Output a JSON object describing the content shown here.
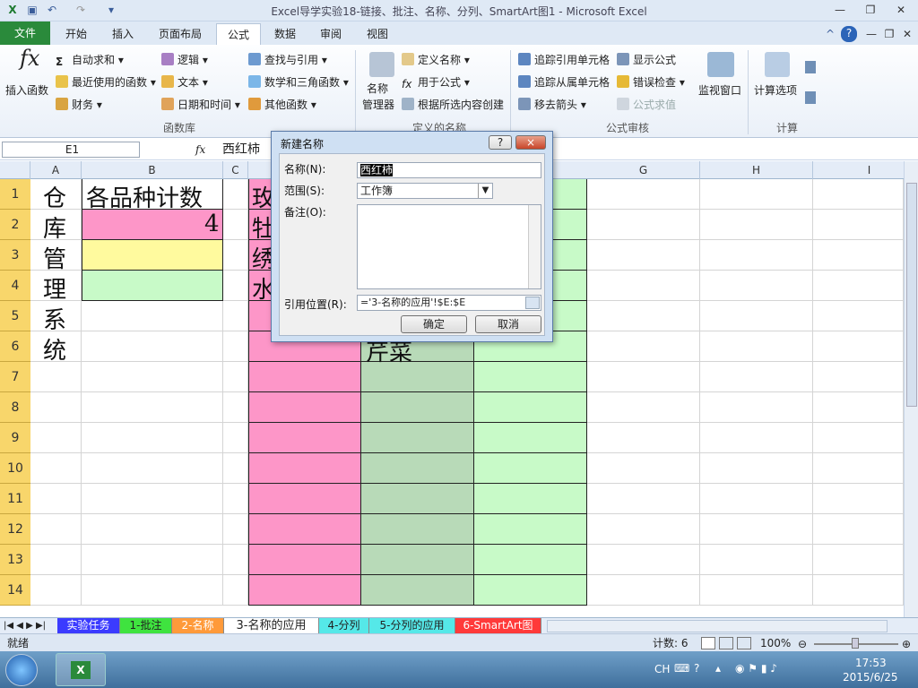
{
  "window": {
    "title": "Excel导学实验18-链接、批注、名称、分列、SmartArt图1 - Microsoft Excel"
  },
  "tabs": [
    "文件",
    "开始",
    "插入",
    "页面布局",
    "公式",
    "数据",
    "审阅",
    "视图"
  ],
  "ribbon": {
    "insert_function": "插入函数",
    "autosum": "自动求和",
    "recent": "最近使用的函数",
    "finance": "财务",
    "logic": "逻辑",
    "text": "文本",
    "datetime": "日期和时间",
    "lookup": "查找与引用",
    "math": "数学和三角函数",
    "more": "其他函数",
    "group_library": "函数库",
    "name_manager_1": "名称",
    "name_manager_2": "管理器",
    "define_name": "定义名称",
    "use_in_formula": "用于公式",
    "create_from_sel": "根据所选内容创建",
    "group_names": "定义的名称",
    "trace_prec": "追踪引用单元格",
    "trace_dep": "追踪从属单元格",
    "remove_arrows": "移去箭头",
    "show_formulas": "显示公式",
    "error_check": "错误检查",
    "eval_formula": "公式求值",
    "group_audit": "公式审核",
    "watch": "监视窗口",
    "calc_options": "计算选项",
    "group_calc": "计算"
  },
  "formula_bar": {
    "namebox": "E1",
    "fx": "fx",
    "content": "西红柿"
  },
  "columns": [
    "A",
    "B",
    "C",
    "G",
    "H",
    "I"
  ],
  "rows": [
    "1",
    "2",
    "3",
    "4",
    "5",
    "6",
    "7",
    "8",
    "9",
    "10",
    "11",
    "12",
    "13",
    "14"
  ],
  "cells": {
    "a_col": [
      "仓",
      "库",
      "管",
      "理",
      "系",
      "统"
    ],
    "b1": "各品种计数",
    "b2": "4",
    "d_col": [
      "玫",
      "牡",
      "绣",
      "水"
    ],
    "e6": "芹菜"
  },
  "dialog": {
    "title": "新建名称",
    "help": "?",
    "close": "×",
    "name_label": "名称(N):",
    "name_value": "西红柿",
    "scope_label": "范围(S):",
    "scope_value": "工作簿",
    "comment_label": "备注(O):",
    "ref_label": "引用位置(R):",
    "ref_value": "='3-名称的应用'!$E:$E",
    "ok": "确定",
    "cancel": "取消"
  },
  "sheet_tabs": [
    "实验任务",
    "1-批注",
    "2-名称",
    "3-名称的应用",
    "4-分列",
    "5-分列的应用",
    "6-SmartArt图"
  ],
  "status": {
    "ready": "就绪",
    "count": "计数: 6",
    "zoom": "100%"
  },
  "taskbar": {
    "lang": "CH",
    "time": "17:53",
    "date": "2015/6/25"
  },
  "colors": {
    "pink": "#fd96c8",
    "yellow": "#fffa9e",
    "green": "#c8fac8",
    "darkgreen": "#b8dab8",
    "rowhdr": "#f8d66b"
  }
}
